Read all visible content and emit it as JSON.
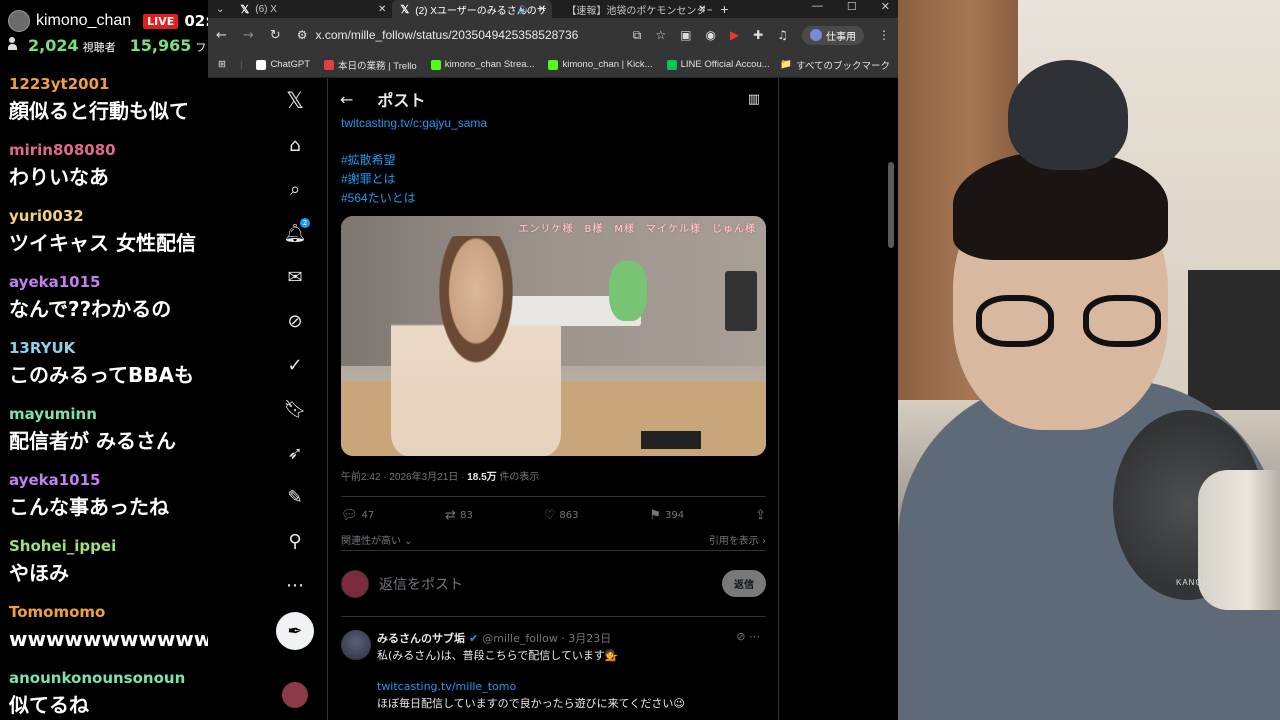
{
  "stream": {
    "channel": "kimono_chan",
    "live": "LIVE",
    "time": "02:",
    "viewers": "2,024",
    "viewers_label": "視聴者",
    "followers": "15,965",
    "followers_label": "フォロ"
  },
  "chat": [
    {
      "user": "1223yt2001",
      "color": "#f0a040",
      "text": "顔似ると行動も似て"
    },
    {
      "user": "mirin808080",
      "color": "#e06a8a",
      "text": "わりいなあ"
    },
    {
      "user": "yuri0032",
      "color": "#f2d27a",
      "text": "ツイキャス 女性配信"
    },
    {
      "user": "ayeka1015",
      "color": "#c080f0",
      "text": "なんで??わかるの"
    },
    {
      "user": "13RYUK",
      "color": "#8fd0e8",
      "text": "このみるってBBAも"
    },
    {
      "user": "mayuminn",
      "color": "#7fe0b0",
      "text": "配信者が みるさん"
    },
    {
      "user": "ayeka1015",
      "color": "#c080f0",
      "text": "こんな事あったね"
    },
    {
      "user": "Shohei_ippei",
      "color": "#9be07a",
      "text": "やほみ"
    },
    {
      "user": "Tomomomo",
      "color": "#f0a040",
      "text": "wwwwwwwwwww"
    },
    {
      "user": "anounkonounsonoun",
      "color": "#7fe0b0",
      "text": "似てるね"
    }
  ],
  "browser": {
    "tabs": [
      {
        "title": "(6) X"
      },
      {
        "title": "(2) Xユーザーのみるさんのサ"
      },
      {
        "title": "【速報】池袋のポケモンセンター"
      }
    ],
    "url": "x.com/mille_follow/status/2035049425358528736",
    "profile": "仕事用",
    "bookmarks": [
      {
        "label": "ChatGPT",
        "color": "#ffffff"
      },
      {
        "label": "本日の業務 | Trello",
        "color": "#e04040"
      },
      {
        "label": "kimono_chan Strea...",
        "color": "#53fc18"
      },
      {
        "label": "kimono_chan | Kick...",
        "color": "#53fc18"
      },
      {
        "label": "LINE Official Accou...",
        "color": "#06c755"
      }
    ],
    "bookmarks_all": "すべてのブックマーク"
  },
  "post": {
    "header_title": "ポスト",
    "link_twitcasting": "twitcasting.tv/c:gajyu_sama",
    "hashtags": [
      "#拡散希望",
      "#謝罪とは",
      "#564たいとは"
    ],
    "media_overlay": "エンリケ様　B様　M様　マイケル様　じゅん様",
    "timestamp": "午前2:42 · 2026年3月21日 · ",
    "views": "18.5万",
    "views_label": " 件の表示",
    "replies": "47",
    "reposts": "83",
    "likes": "863",
    "bookmarks": "394",
    "relevance": "関連性が高い",
    "quotes": "引用を表示",
    "reply_placeholder": "返信をポスト",
    "reply_button": "返信"
  },
  "reply_tweet": {
    "name": "みるさんのサブ垢",
    "handle": "@mille_follow · 3月23日",
    "text": "私(みるさん)は、普段こちらで配信しています💁",
    "link": "twitcasting.tv/mille_tomo",
    "text2": "ほぼ毎日配信していますので良かったら遊びに来てください😉"
  },
  "webcam": {
    "logo": "KANGOL"
  }
}
